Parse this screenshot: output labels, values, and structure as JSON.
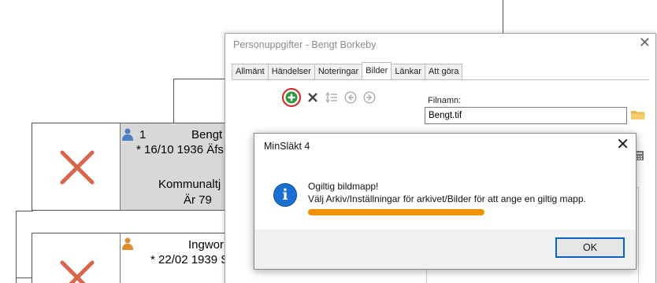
{
  "tree": {
    "person1": {
      "number": "1",
      "name": "Bengt",
      "birth": "* 16/10 1936 Äfs",
      "occupation": "Kommunaltj",
      "age": "Är 79"
    },
    "person2": {
      "name": "Ingwor",
      "birth": "* 22/02 1939 S"
    }
  },
  "person_window": {
    "title": "Personuppgifter - Bengt Borkeby",
    "close_glyph": "✕",
    "tabs": [
      "Allmänt",
      "Händelser",
      "Noteringar",
      "Bilder",
      "Länkar",
      "Att göra"
    ],
    "active_tab": "Bilder",
    "filename_label": "Filnamn:",
    "filename_value": "Bengt.tif",
    "chevron_glyph": "⌃"
  },
  "message_box": {
    "title": "MinSläkt 4",
    "close_glyph": "✕",
    "icon_glyph": "i",
    "line1": "Ogiltig bildmapp!",
    "line2": "Välj Arkiv/Inställningar för arkivet/Bilder för att ange en giltig mapp.",
    "ok_label": "OK"
  },
  "colors": {
    "accent_blue": "#0a64c8",
    "info_blue": "#1a6fd0",
    "highlight_orange": "#f29100",
    "annotation_red": "#d92020",
    "cross_red": "#d8664a",
    "add_green": "#2e9a3e",
    "male_icon": "#4a7fc1",
    "female_icon": "#e08a2e"
  }
}
